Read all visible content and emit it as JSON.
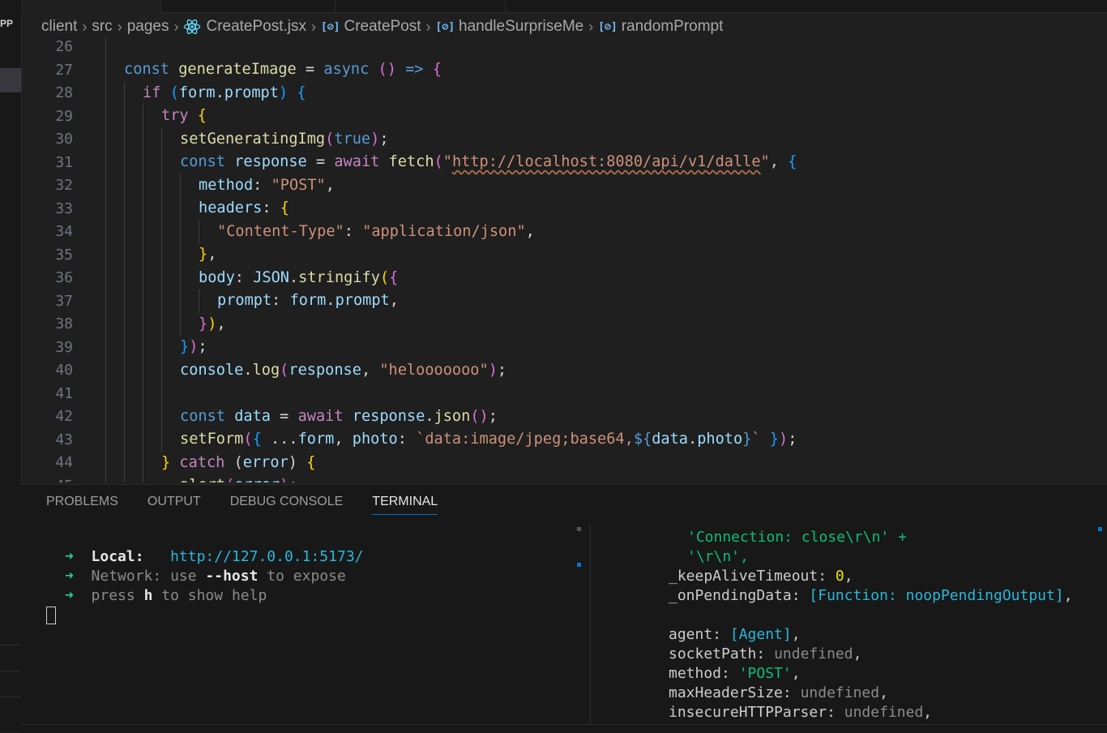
{
  "left_strip": {
    "label": "PP"
  },
  "breadcrumb": {
    "items": [
      "client",
      "src",
      "pages",
      "CreatePost.jsx",
      "CreatePost",
      "handleSurpriseMe",
      "randomPrompt"
    ]
  },
  "editor": {
    "line_numbers": [
      "26",
      "27",
      "28",
      "29",
      "30",
      "31",
      "32",
      "33",
      "34",
      "35",
      "36",
      "37",
      "38",
      "39",
      "40",
      "41",
      "42",
      "43",
      "44",
      "45"
    ]
  },
  "panel": {
    "tabs": [
      "PROBLEMS",
      "OUTPUT",
      "DEBUG CONSOLE",
      "TERMINAL"
    ],
    "active_tab": "TERMINAL"
  },
  "terminal_left": {
    "local_label": "Local:",
    "local_url": "http://127.0.0.1:5173/",
    "network_label": "Network:",
    "network_text_1": " use ",
    "network_flag": "--host",
    "network_text_2": " to expose",
    "press_text_1": "press ",
    "press_key": "h",
    "press_text_2": " to show help"
  },
  "terminal_right": {
    "line1": "'Connection: close\\r\\n' +",
    "line2": "'\\r\\n',",
    "keepalive_key": "_keepAliveTimeout:",
    "keepalive_val": "0",
    "pending_key": "_onPendingData:",
    "pending_val": "[Function: noopPendingOutput]",
    "agent_key": "agent:",
    "agent_val": "[Agent]",
    "socket_key": "socketPath:",
    "socket_val": "undefined",
    "method_key": "method:",
    "method_val": "'POST'",
    "maxheader_key": "maxHeaderSize:",
    "maxheader_val": "undefined",
    "insecure_key": "insecureHTTPParser:",
    "insecure_val": "undefined"
  },
  "colors": {
    "keyword": "#569cd6",
    "control": "#c586c0",
    "function": "#dcdcaa",
    "variable": "#9cdcfe",
    "string": "#ce9178",
    "terminal_green": "#23d18b",
    "accent": "#0078d4"
  }
}
